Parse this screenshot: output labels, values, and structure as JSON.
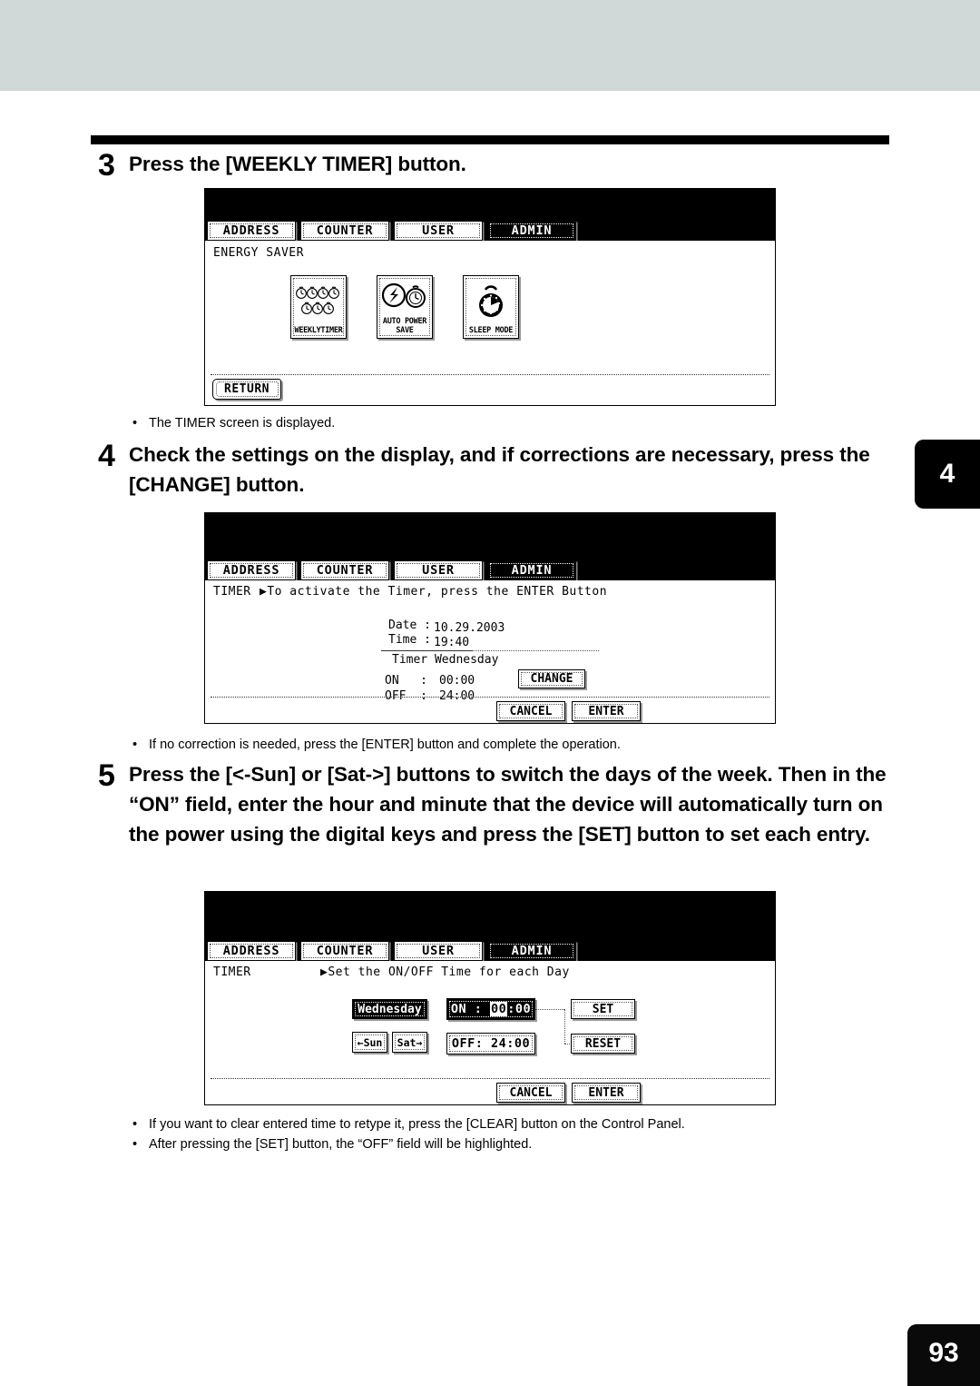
{
  "document": {
    "page_number": "93",
    "chapter_tab": "4"
  },
  "steps": [
    {
      "number": "3",
      "text": "Press the [WEEKLY TIMER] button."
    },
    {
      "number": "4",
      "text": "Check the settings on the display, and if corrections are necessary, press the [CHANGE] button."
    },
    {
      "number": "5",
      "text": "Press the [<-Sun] or [Sat->] buttons to switch the days of the week. Then in the “ON” field, enter the hour and minute that the device will automatically turn on the power using the digital keys and press the [SET] button to set each entry."
    }
  ],
  "notes": [
    {
      "text": "The TIMER screen is displayed."
    },
    {
      "text": "If no correction is needed, press the [ENTER] button and complete the operation."
    },
    {
      "text": "If you want to clear entered time to retype it, press the [CLEAR] button on the Control Panel."
    },
    {
      "text": "After pressing the [SET] button, the “OFF” field will be highlighted."
    }
  ],
  "tabs": [
    {
      "label": "ADDRESS",
      "active": false
    },
    {
      "label": "COUNTER",
      "active": false
    },
    {
      "label": "USER",
      "active": false
    },
    {
      "label": "ADMIN",
      "active": true
    }
  ],
  "screen_energy_saver": {
    "title": "ENERGY SAVER",
    "buttons": [
      {
        "caption": "WEEKLYTIMER",
        "icon": "weekly-timer-icon"
      },
      {
        "caption": "AUTO POWER\nSAVE",
        "icon": "auto-power-save-icon"
      },
      {
        "caption": "SLEEP MODE",
        "icon": "sleep-mode-icon"
      }
    ],
    "return_label": "RETURN"
  },
  "screen_timer_overview": {
    "title": "TIMER",
    "instruction": "▶To activate the Timer, press the ENTER Button",
    "fields": {
      "date_label": "Date :",
      "date_value": "10.29.2003",
      "time_label": "Time :",
      "time_value": "19:40",
      "timer_day": "Timer Wednesday",
      "on_label": "ON   :",
      "on_value": "00:00",
      "off_label": "OFF  :",
      "off_value": "24:00"
    },
    "change_label": "CHANGE",
    "cancel_label": "CANCEL",
    "enter_label": "ENTER"
  },
  "screen_timer_edit": {
    "title": "TIMER",
    "instruction": "▶Set the ON/OFF Time for each Day",
    "day_label": "Wednesday",
    "prev_day_label": "←Sun",
    "next_day_label": "Sat→",
    "on_prefix": "ON :",
    "on_hour": "00",
    "on_sep": ":",
    "on_minute": "00",
    "off_prefix": "OFF:",
    "off_hour": "24",
    "off_sep": ":",
    "off_minute": "00",
    "set_label": "SET",
    "reset_label": "RESET",
    "cancel_label": "CANCEL",
    "enter_label": "ENTER"
  },
  "colors": {
    "header_band": "#d0d9d7",
    "ink": "#000000",
    "paper": "#ffffff"
  }
}
